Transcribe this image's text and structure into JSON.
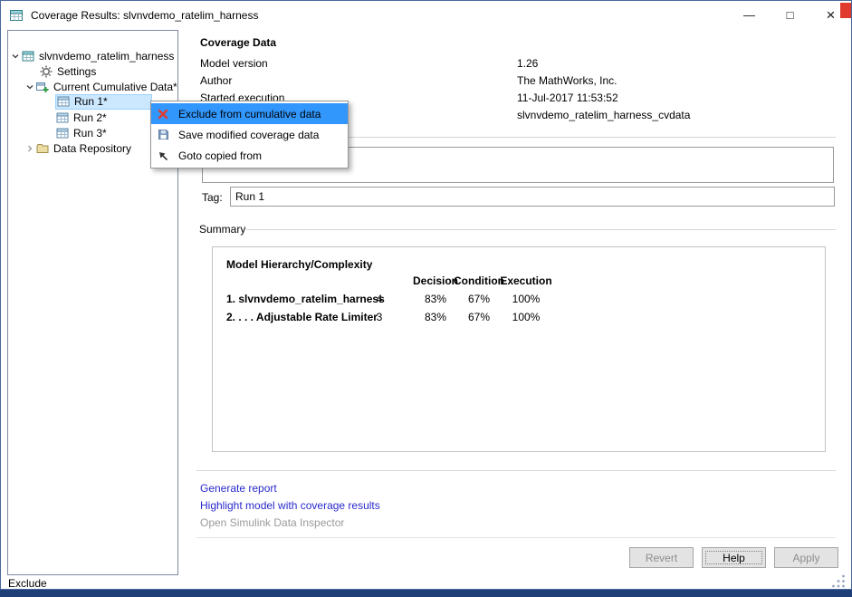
{
  "window": {
    "title": "Coverage Results: slvnvdemo_ratelim_harness",
    "minimize_glyph": "—",
    "maximize_glyph": "□",
    "close_glyph": "×"
  },
  "tree": {
    "root": "slvnvdemo_ratelim_harness",
    "settings": "Settings",
    "cumulative": "Current Cumulative Data*",
    "run1": "Run 1*",
    "run2": "Run 2*",
    "run3": "Run 3*",
    "repository": "Data Repository"
  },
  "context_menu": {
    "exclude": "Exclude from cumulative data",
    "save": "Save modified coverage data",
    "goto": "Goto copied from"
  },
  "details": {
    "heading": "Coverage Data",
    "rows": [
      {
        "label": "Model version",
        "value": "1.26"
      },
      {
        "label": "Author",
        "value": "The MathWorks, Inc."
      },
      {
        "label": "Started execution",
        "value": "11-Jul-2017 11:53:52"
      },
      {
        "label": "",
        "value": "slvnvdemo_ratelim_harness_cvdata"
      }
    ],
    "description_value": "",
    "tag_label": "Tag:",
    "tag_value": "Run 1"
  },
  "summary": {
    "heading": "Summary",
    "table_title": "Model Hierarchy/Complexity",
    "col_decision": "Decision",
    "col_condition": "Condition",
    "col_execution": "Execution",
    "rows": [
      {
        "name": "1. slvnvdemo_ratelim_harness",
        "complexity": "4",
        "decision": "83%",
        "condition": "67%",
        "execution": "100%"
      },
      {
        "name": "2. . . . Adjustable Rate Limiter",
        "complexity": "3",
        "decision": "83%",
        "condition": "67%",
        "execution": "100%"
      }
    ]
  },
  "links": {
    "generate": "Generate report",
    "highlight": "Highlight model with coverage results",
    "inspector": "Open Simulink Data Inspector"
  },
  "buttons": {
    "revert": "Revert",
    "help": "Help",
    "apply": "Apply"
  },
  "statusbar": {
    "text": "Exclude"
  },
  "icons": {
    "app": "coverage-grid",
    "settings": "gear",
    "repository": "folder",
    "exclude": "red-x",
    "save": "floppy-disk",
    "goto": "nw-arrow",
    "expanded": "chevron-down",
    "collapsed": "chevron-right"
  },
  "colors": {
    "menu_highlight": "#3297fd",
    "tree_selection_bg": "#cce8ff",
    "tree_selection_border": "#9ad1ff",
    "link": "#2929cc",
    "link_disabled": "#9a9a9a",
    "taskbar": "#1e3f77",
    "exclude_red": "#e03c31"
  }
}
